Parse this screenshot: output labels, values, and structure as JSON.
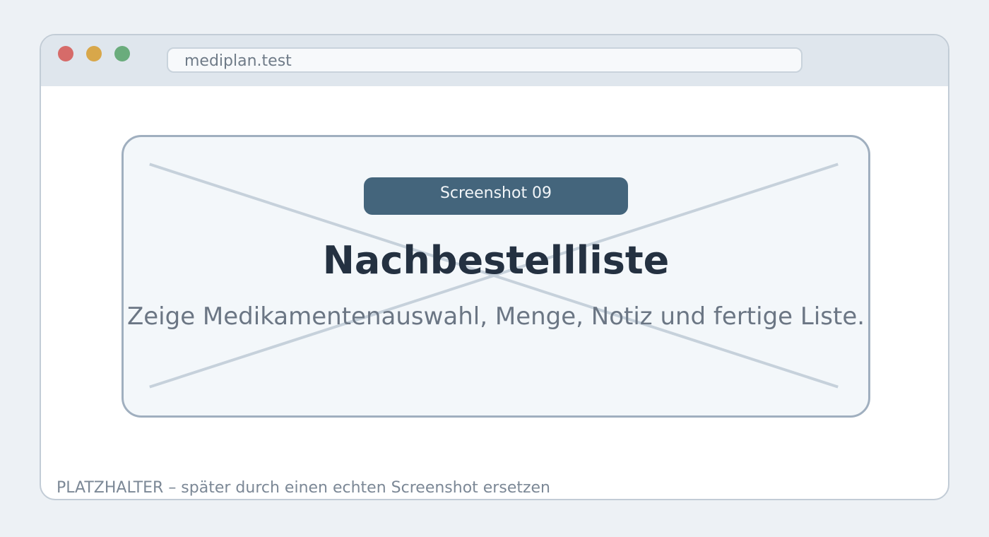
{
  "browser": {
    "address": "mediplan.test",
    "traffic_lights": {
      "close_color": "#d66b69",
      "minimize_color": "#d8a74a",
      "maximize_color": "#6aac7c"
    }
  },
  "placeholder": {
    "badge": "Screenshot 09",
    "title": "Nachbestellliste",
    "subtitle": "Zeige Medikamentenauswahl, Menge, Notiz und fertige Liste.",
    "note": "PLATZHALTER – später durch einen echten Screenshot ersetzen"
  },
  "colors": {
    "page_background": "#edf1f5",
    "titlebar": "#dfe6ed",
    "badge": "#44657c",
    "title_text": "#243141",
    "subtitle_text": "#6b7684"
  }
}
